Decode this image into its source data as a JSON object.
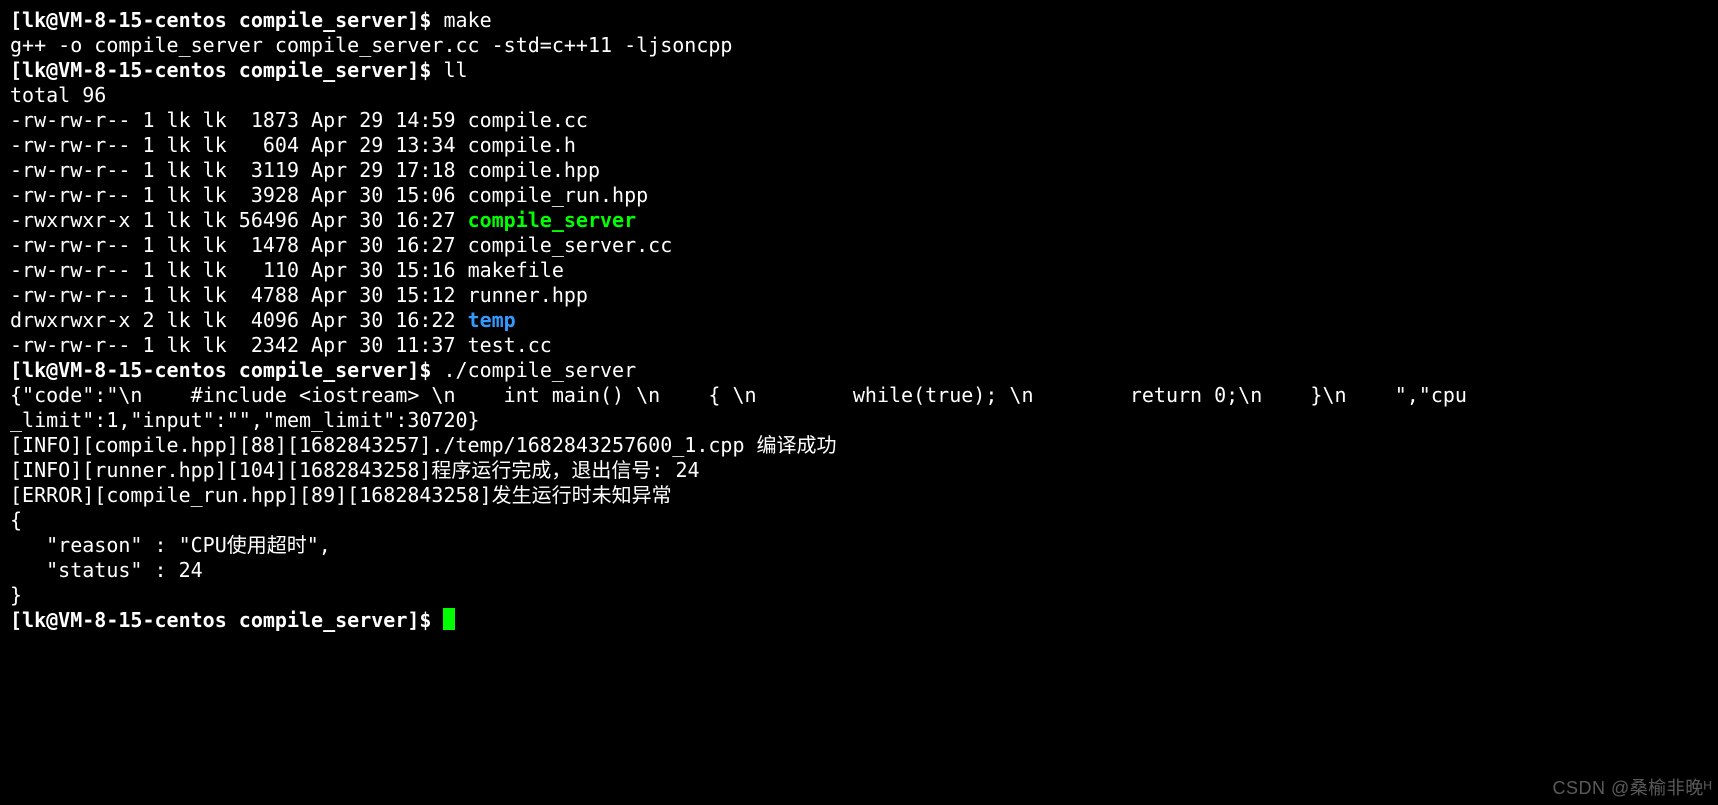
{
  "prompt": "[lk@VM-8-15-centos compile_server]$ ",
  "cmd_make": "make",
  "make_out": "g++ -o compile_server compile_server.cc -std=c++11 -ljsoncpp",
  "cmd_ll": "ll",
  "ll_total": "total 96",
  "ls": [
    {
      "perm": "-rw-rw-r--",
      "links": "1",
      "owner": "lk",
      "group": "lk",
      "size": " 1873",
      "date": "Apr 29 14:59",
      "name": "compile.cc",
      "color": ""
    },
    {
      "perm": "-rw-rw-r--",
      "links": "1",
      "owner": "lk",
      "group": "lk",
      "size": "  604",
      "date": "Apr 29 13:34",
      "name": "compile.h",
      "color": ""
    },
    {
      "perm": "-rw-rw-r--",
      "links": "1",
      "owner": "lk",
      "group": "lk",
      "size": " 3119",
      "date": "Apr 29 17:18",
      "name": "compile.hpp",
      "color": ""
    },
    {
      "perm": "-rw-rw-r--",
      "links": "1",
      "owner": "lk",
      "group": "lk",
      "size": " 3928",
      "date": "Apr 30 15:06",
      "name": "compile_run.hpp",
      "color": ""
    },
    {
      "perm": "-rwxrwxr-x",
      "links": "1",
      "owner": "lk",
      "group": "lk",
      "size": "56496",
      "date": "Apr 30 16:27",
      "name": "compile_server",
      "color": "green"
    },
    {
      "perm": "-rw-rw-r--",
      "links": "1",
      "owner": "lk",
      "group": "lk",
      "size": " 1478",
      "date": "Apr 30 16:27",
      "name": "compile_server.cc",
      "color": ""
    },
    {
      "perm": "-rw-rw-r--",
      "links": "1",
      "owner": "lk",
      "group": "lk",
      "size": "  110",
      "date": "Apr 30 15:16",
      "name": "makefile",
      "color": ""
    },
    {
      "perm": "-rw-rw-r--",
      "links": "1",
      "owner": "lk",
      "group": "lk",
      "size": " 4788",
      "date": "Apr 30 15:12",
      "name": "runner.hpp",
      "color": ""
    },
    {
      "perm": "drwxrwxr-x",
      "links": "2",
      "owner": "lk",
      "group": "lk",
      "size": " 4096",
      "date": "Apr 30 16:22",
      "name": "temp",
      "color": "blue"
    },
    {
      "perm": "-rw-rw-r--",
      "links": "1",
      "owner": "lk",
      "group": "lk",
      "size": " 2342",
      "date": "Apr 30 11:37",
      "name": "test.cc",
      "color": ""
    }
  ],
  "cmd_run": "./compile_server",
  "json_l1": "{\"code\":\"\\n    #include <iostream> \\n    int main() \\n    { \\n        while(true); \\n        return 0;\\n    }\\n    \",\"cpu",
  "json_l2": "_limit\":1,\"input\":\"\",\"mem_limit\":30720}",
  "blank": "",
  "info1": "[INFO][compile.hpp][88][1682843257]./temp/1682843257600_1.cpp 编译成功",
  "info2": "[INFO][runner.hpp][104][1682843258]程序运行完成，退出信号: 24",
  "error1": "[ERROR][compile_run.hpp][89][1682843258]发生运行时未知异常",
  "jbrace_open": "{",
  "jline1": "   \"reason\" : \"CPU使用超时\",",
  "jline2": "   \"status\" : 24",
  "jbrace_close": "}",
  "watermark": "CSDN @桑榆非晚ᴴ"
}
